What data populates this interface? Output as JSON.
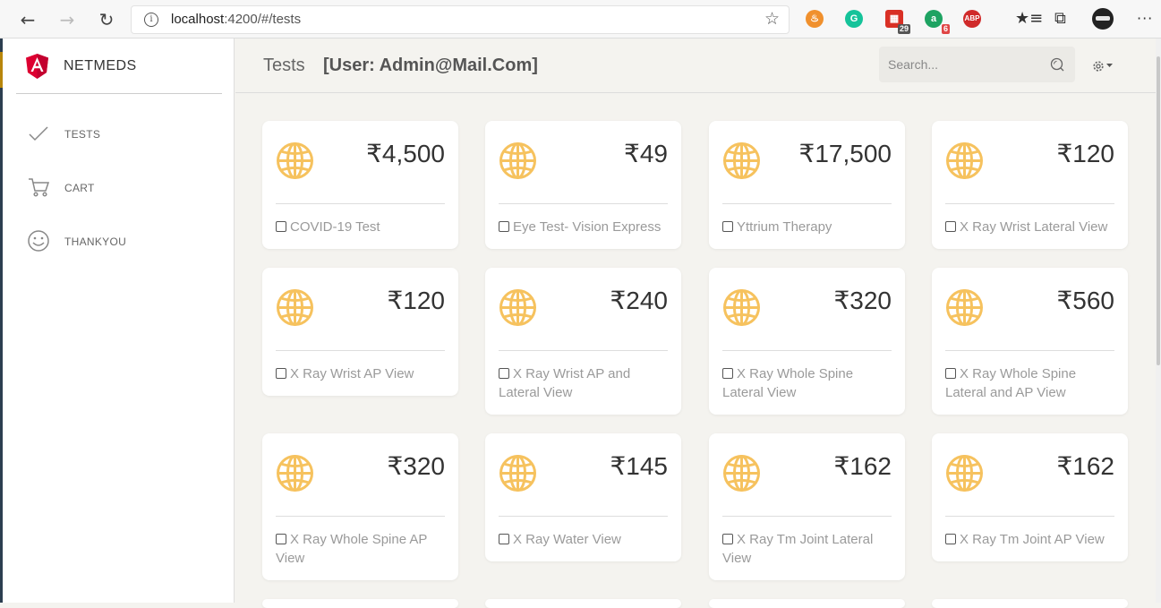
{
  "browser": {
    "url_host": "localhost",
    "url_path": ":4200/#/tests",
    "ext_calendar_badge": "29",
    "ext_a_badge": "6",
    "ext_abp_label": "ABP",
    "ext_g_label": "G",
    "ext_a_label": "a"
  },
  "sidebar": {
    "brand": "NETMEDS",
    "items": [
      {
        "label": "TESTS",
        "icon": "check-icon"
      },
      {
        "label": "CART",
        "icon": "cart-icon"
      },
      {
        "label": "THANKYOU",
        "icon": "smiley-icon"
      }
    ]
  },
  "header": {
    "title": "Tests",
    "user": "[User: Admin@Mail.Com]",
    "search_placeholder": "Search..."
  },
  "cards": [
    {
      "price": "₹4,500",
      "name": "COVID-19 Test"
    },
    {
      "price": "₹49",
      "name": "Eye Test- Vision Express"
    },
    {
      "price": "₹17,500",
      "name": "Yttrium Therapy"
    },
    {
      "price": "₹120",
      "name": "X Ray Wrist Lateral View"
    },
    {
      "price": "₹120",
      "name": "X Ray Wrist AP View"
    },
    {
      "price": "₹240",
      "name": "X Ray Wrist AP and Lateral View"
    },
    {
      "price": "₹320",
      "name": "X Ray Whole Spine Lateral View"
    },
    {
      "price": "₹560",
      "name": "X Ray Whole Spine Lateral and AP View"
    },
    {
      "price": "₹320",
      "name": "X Ray Whole Spine AP View"
    },
    {
      "price": "₹145",
      "name": "X Ray Water View"
    },
    {
      "price": "₹162",
      "name": "X Ray Tm Joint Lateral View"
    },
    {
      "price": "₹162",
      "name": "X Ray Tm Joint AP View"
    }
  ],
  "colors": {
    "accent_globe": "#f6c25e",
    "angular_red": "#dd0031"
  }
}
